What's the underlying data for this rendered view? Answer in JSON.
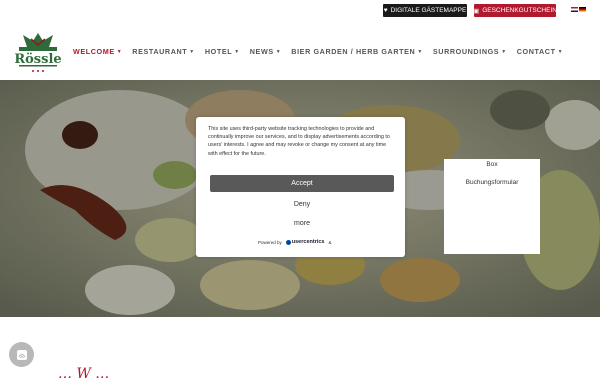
{
  "topbar": {
    "digital_label": "DIGITALE GÄSTEMAPPE",
    "gift_label": "GESCHENKGUTSCHEIN",
    "digital_icon": "heart-icon",
    "gift_icon": "gift-icon",
    "languages": [
      "English",
      "Deutsch"
    ]
  },
  "logo": {
    "alt": "Rössle",
    "name": "Rössle"
  },
  "nav": {
    "items": [
      {
        "label": "WELCOME",
        "active": true
      },
      {
        "label": "RESTAURANT",
        "active": false
      },
      {
        "label": "HOTEL",
        "active": false
      },
      {
        "label": "NEWS",
        "active": false
      },
      {
        "label": "BIER GARDEN / HERB GARTEN",
        "active": false
      },
      {
        "label": "SURROUNDINGS",
        "active": false
      },
      {
        "label": "CONTACT",
        "active": false
      }
    ]
  },
  "box": {
    "title": "Box",
    "link": "Buchungsformular"
  },
  "cookie": {
    "text": "This site uses third-party website tracking technologies to provide and continually improve our services, and to display advertisements according to users' interests. I agree and may revoke or change my consent at any time with effect for the future.",
    "accept": "Accept",
    "deny": "Deny",
    "more": "more",
    "powered_by": "Powered by",
    "brand": "usercentrics",
    "brand_suffix": "&"
  },
  "fingerprint_icon": "fingerprint-icon",
  "bottom_text": "… W …",
  "colors": {
    "accent": "#b0192f",
    "dark": "#1a1a1a"
  }
}
